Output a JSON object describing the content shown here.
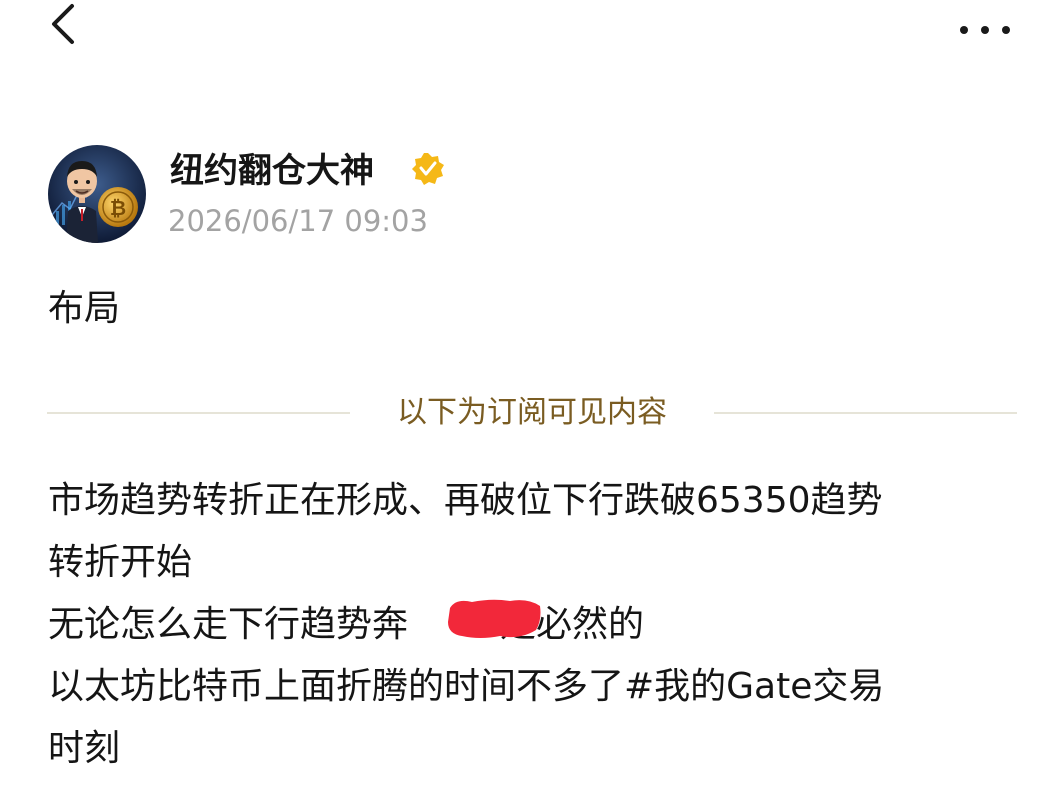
{
  "header": {
    "back_icon": "chevron-left-icon",
    "more_icon": "more-horizontal-icon"
  },
  "author": {
    "name": "纽约翻仓大神",
    "timestamp": "2026/06/17 09:03",
    "verified_icon": "verified-badge-icon",
    "badge_color": "#f5b817"
  },
  "post": {
    "title": "布局",
    "divider_label": "以下为订阅可见内容",
    "divider_label_color": "#7a5c22",
    "body_lines": [
      "市场趋势转折正在形成、再破位下行跌破65350趋势",
      "转折开始",
      "无论怎么走下行趋势奔",
      "是必然的",
      "以太坊比特币上面折腾的时间不多了#我的Gate交易",
      "时刻"
    ],
    "redaction_color": "#f2283a"
  }
}
